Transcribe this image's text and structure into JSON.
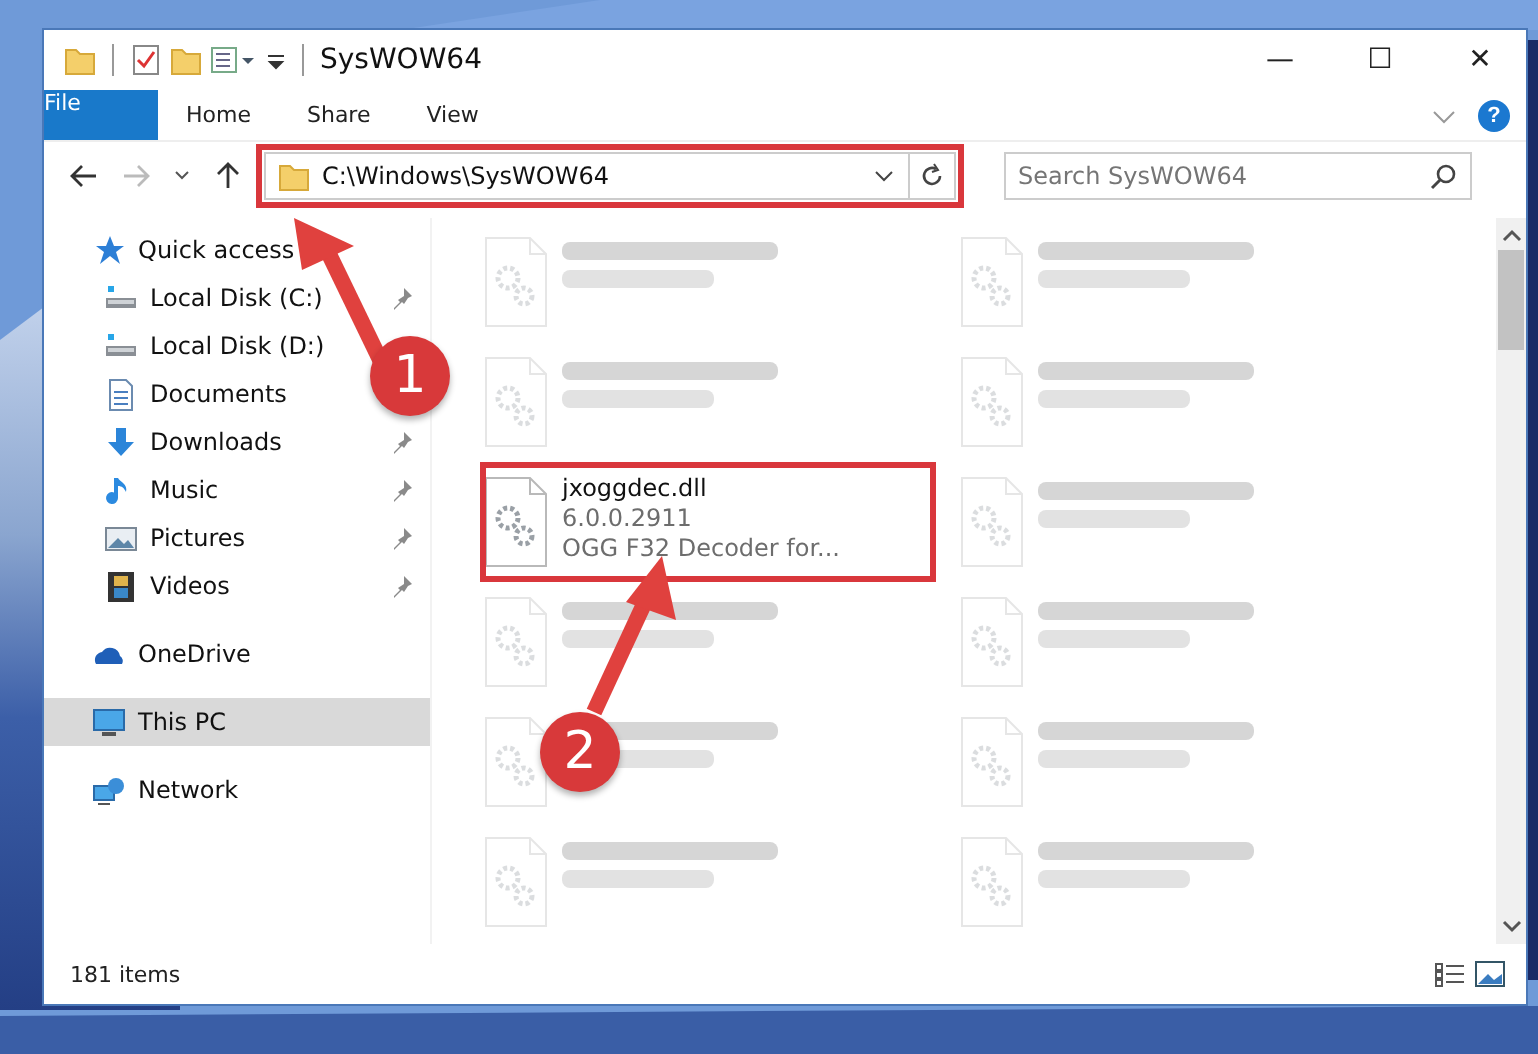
{
  "window": {
    "title": "SysWOW64",
    "minimize": "—",
    "maximize": "☐",
    "close": "✕"
  },
  "ribbon": {
    "tabs": [
      {
        "label": "File",
        "kind": "file"
      },
      {
        "label": "Home",
        "kind": "tab"
      },
      {
        "label": "Share",
        "kind": "tab"
      },
      {
        "label": "View",
        "kind": "tab"
      }
    ],
    "help": "?"
  },
  "address_bar": {
    "path": "C:\\Windows\\SysWOW64"
  },
  "search": {
    "placeholder": "Search SysWOW64"
  },
  "navigation": [
    {
      "label": "Quick access",
      "selected": false,
      "children": [
        {
          "label": "Local Disk (C:)",
          "pinned": true
        },
        {
          "label": "Local Disk (D:)"
        },
        {
          "label": "Documents"
        },
        {
          "label": "Downloads",
          "pinned": true
        },
        {
          "label": "Music",
          "pinned": true
        },
        {
          "label": "Pictures",
          "pinned": true
        },
        {
          "label": "Videos",
          "pinned": true
        }
      ]
    },
    {
      "label": "OneDrive",
      "selected": false
    },
    {
      "label": "This PC",
      "selected": true
    },
    {
      "label": "Network",
      "selected": false
    }
  ],
  "files": [
    {
      "blurred": true
    },
    {
      "blurred": true
    },
    {
      "blurred": true
    },
    {
      "blurred": true
    },
    {
      "name": "jxoggdec.dll",
      "lines": [
        "6.0.0.2911",
        "OGG F32 Decoder for..."
      ],
      "blurred": false
    },
    {
      "blurred": true
    },
    {
      "blurred": true
    },
    {
      "blurred": true
    },
    {
      "blurred": true
    },
    {
      "blurred": true
    },
    {
      "blurred": true
    },
    {
      "blurred": true
    }
  ],
  "status_bar": {
    "count": "181 items"
  },
  "annotations": [
    {
      "label": "1"
    },
    {
      "label": "2"
    }
  ]
}
